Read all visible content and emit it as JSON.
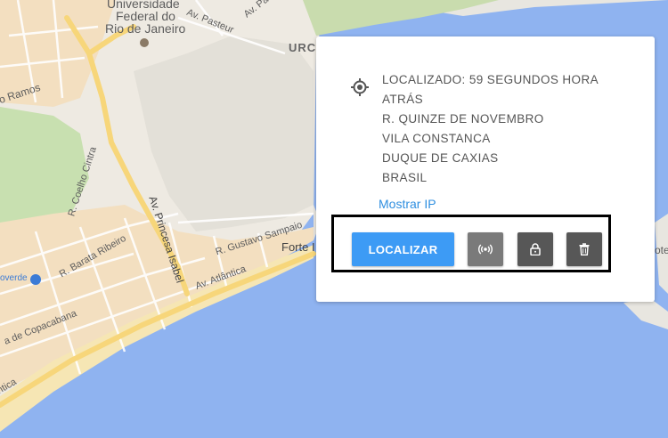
{
  "map": {
    "labels": {
      "university_1": "Universidade",
      "university_2": "Federal do",
      "university_3": "Rio de Janeiro",
      "av_pasteur": "Av. Pasteur",
      "av_pa_top": "Av. Pa",
      "urca": "URCA",
      "ramos": "o Ramos",
      "coelho_cintra": "R. Coelho Cintra",
      "princesa_isabel": "Av. Princesa Isabel",
      "gustavo_sampaio": "R. Gustavo Sampaio",
      "barata_ribeiro": "R. Barata Ribeiro",
      "forte": "Forte I",
      "av_atlantica_1": "Av. Atlântica",
      "av_atlantica_2": "ntica",
      "copacabana": "a de Copacabana",
      "metro": "overde",
      "right_edge": "ote"
    }
  },
  "card": {
    "address_lines": [
      "LOCALIZADO: 59 SEGUNDOS HORA",
      "ATRÁS",
      "R. QUINZE DE NOVEMBRO",
      "VILA CONSTANCA",
      "DUQUE DE CAXIAS",
      "BRASIL"
    ],
    "show_ip": "Mostrar IP",
    "locate_button": "LOCALIZAR",
    "buttons": {
      "signal_icon": "signal-broadcast-icon",
      "lock_icon": "lock-icon",
      "delete_icon": "trash-icon"
    },
    "colors": {
      "primary": "#3d9bf5",
      "signal_bg": "#7a7a7a",
      "dark_bg": "#575757",
      "link": "#2f8fe0"
    }
  }
}
